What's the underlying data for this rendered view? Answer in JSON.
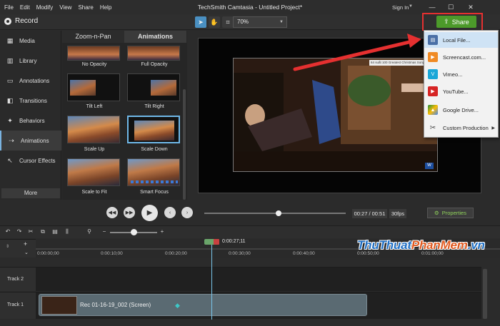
{
  "menu": [
    "File",
    "Edit",
    "Modify",
    "View",
    "Share",
    "Help"
  ],
  "app_title": "TechSmith Camtasia - Untitled Project*",
  "signin": "Sign In",
  "window_buttons": {
    "minimize": "—",
    "maximize": "☐",
    "close": "✕"
  },
  "toolbar": {
    "record_label": "Record",
    "zoom_value": "70%"
  },
  "share": {
    "button_label": "Share",
    "items": [
      {
        "label": "Local File...",
        "icon": "local-file-icon",
        "color": "#4a6fa5"
      },
      {
        "label": "Screencast.com...",
        "icon": "screencast-icon",
        "color": "#f08a24"
      },
      {
        "label": "Vimeo...",
        "icon": "vimeo-icon",
        "color": "#1aa7d8"
      },
      {
        "label": "YouTube...",
        "icon": "youtube-icon",
        "color": "#d62424"
      },
      {
        "label": "Google Drive...",
        "icon": "google-drive-icon",
        "color": "#3a7d2c"
      },
      {
        "label": "Custom Production",
        "icon": "tools-icon",
        "color": "#555555"
      }
    ]
  },
  "sidebar": {
    "items": [
      {
        "label": "Media",
        "icon": "media-icon"
      },
      {
        "label": "Library",
        "icon": "library-icon"
      },
      {
        "label": "Annotations",
        "icon": "annotations-icon"
      },
      {
        "label": "Transitions",
        "icon": "transitions-icon"
      },
      {
        "label": "Behaviors",
        "icon": "behaviors-icon"
      },
      {
        "label": "Animations",
        "icon": "animations-icon"
      },
      {
        "label": "Cursor Effects",
        "icon": "cursor-effects-icon"
      }
    ],
    "more_label": "More"
  },
  "panel": {
    "tabs": [
      "Zoom-n-Pan",
      "Animations"
    ],
    "thumbs": [
      "No Opacity",
      "Full Opacity",
      "Tilt Left",
      "Tilt Right",
      "Scale Up",
      "Scale Down",
      "Scale to Fit",
      "Smart Focus"
    ]
  },
  "video": {
    "banner": "64 suất 100 Greatest Christmas Songs Ev"
  },
  "playback": {
    "timecode": "00:27 / 00:51",
    "fps": "30fps",
    "properties_label": "Properties"
  },
  "timeline": {
    "playhead_time": "0:00:27;11",
    "ticks": [
      "0:00:00;00",
      "0:00:10;00",
      "0:00:20;00",
      "0:00:30;00",
      "0:00:40;00",
      "0:00:50;00",
      "0:01:00;00"
    ],
    "tracks": [
      "Track 2",
      "Track 1"
    ],
    "clip_label": "Rec 01-16-19_002 (Screen)"
  },
  "watermark": {
    "part1": "ThuThuat",
    "part2": "PhanMem",
    "part3": ".vn"
  }
}
